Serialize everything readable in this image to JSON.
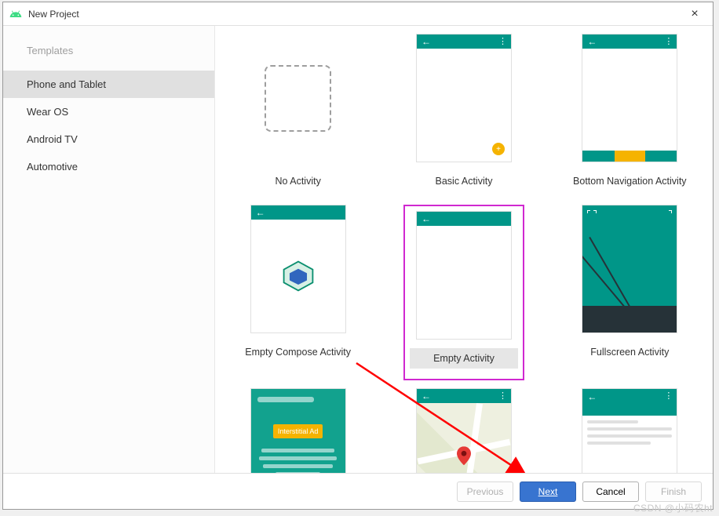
{
  "titlebar": {
    "title": "New Project",
    "close": "×"
  },
  "sidebar": {
    "header": "Templates",
    "items": [
      {
        "label": "Phone and Tablet",
        "active": true
      },
      {
        "label": "Wear OS",
        "active": false
      },
      {
        "label": "Android TV",
        "active": false
      },
      {
        "label": "Automotive",
        "active": false
      }
    ]
  },
  "templates": {
    "row1": [
      {
        "label": "No Activity"
      },
      {
        "label": "Basic Activity"
      },
      {
        "label": "Bottom Navigation Activity"
      }
    ],
    "row2": [
      {
        "label": "Empty Compose Activity"
      },
      {
        "label": "Empty Activity",
        "selected": true
      },
      {
        "label": "Fullscreen Activity"
      }
    ],
    "row3": [
      {
        "label": "",
        "ad_text": "Interstitial Ad"
      },
      {
        "label": ""
      },
      {
        "label": ""
      }
    ]
  },
  "footer": {
    "previous": "Previous",
    "next": "Next",
    "cancel": "Cancel",
    "finish": "Finish"
  },
  "watermark": "CSDN @小码农ht",
  "colors": {
    "teal": "#009688",
    "accent": "#f5b300",
    "selection": "#d028d0",
    "primary_btn": "#3874d0"
  }
}
